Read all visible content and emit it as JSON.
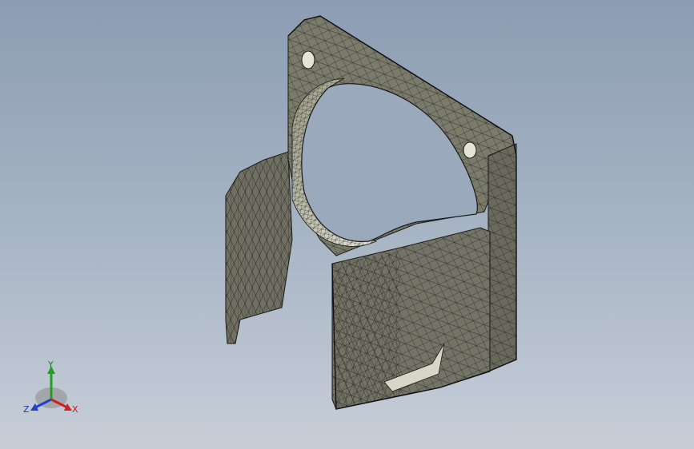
{
  "viewport": {
    "background_top": "#8c9db3",
    "background_bottom": "#c7ced8",
    "model": {
      "name": "",
      "render_mode": "shaded-with-mesh-edges",
      "face_color": "#7b7b6c",
      "edge_color": "#1a1a16"
    }
  },
  "triad": {
    "x_label": "X",
    "y_label": "Y",
    "z_label": "Z",
    "x_color": "#d02020",
    "y_color": "#20a020",
    "z_color": "#2040d0"
  }
}
